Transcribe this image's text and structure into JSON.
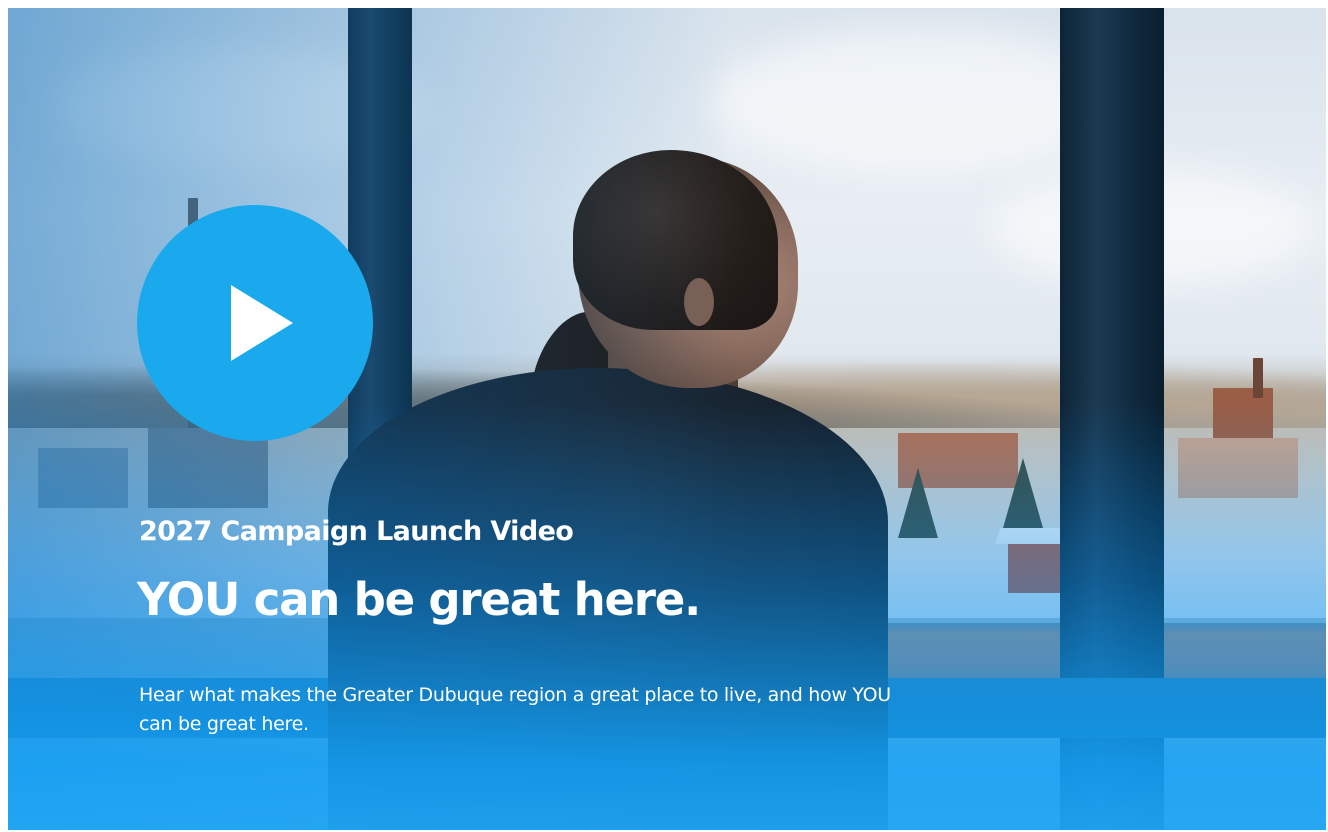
{
  "video_card": {
    "kicker": "2027 Campaign Launch Video",
    "headline": "YOU can be great here.",
    "description": "Hear what makes the Greater Dubuque region a great place to live, and how YOU can be great here.",
    "play_icon": "play-icon",
    "colors": {
      "play_button": "#1aa9ec",
      "overlay_blue": "#1ea5f5",
      "text": "#ffffff"
    }
  }
}
